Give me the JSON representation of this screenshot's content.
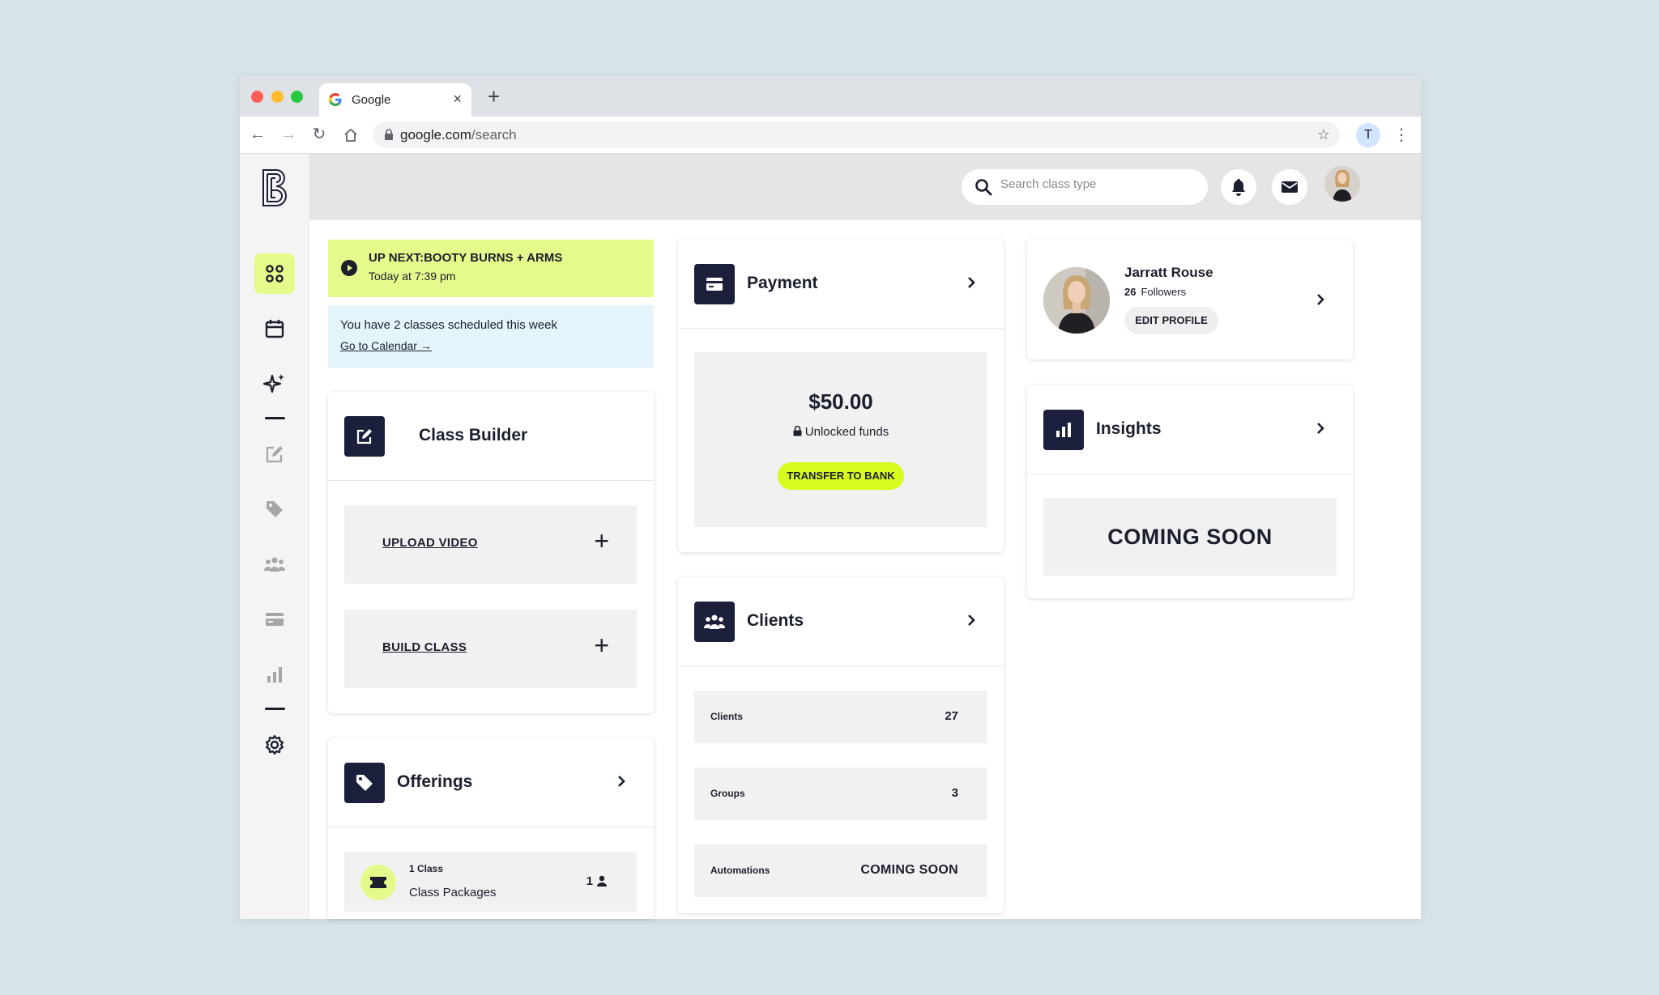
{
  "browser": {
    "tab_title": "Google",
    "tab_close": "×",
    "new_tab": "+",
    "url_host": "google.com",
    "url_path": "/search",
    "profile_initial": "T"
  },
  "topbar": {
    "search_placeholder": "Search class type"
  },
  "upnext": {
    "title": "UP NEXT:BOOTY BURNS + ARMS",
    "time": "Today at 7:39 pm"
  },
  "week": {
    "message": "You have 2 classes scheduled this week",
    "calendar_link": "Go to Calendar →"
  },
  "class_builder": {
    "title": "Class Builder",
    "upload_label": "UPLOAD VIDEO",
    "build_label": "BUILD CLASS",
    "plus": "+"
  },
  "offerings": {
    "title": "Offerings",
    "item_small": "1 Class",
    "item_label": "Class Packages",
    "item_count": "1"
  },
  "payment": {
    "title": "Payment",
    "amount": "$50.00",
    "unlocked": "Unlocked funds",
    "transfer_label": "TRANSFER TO BANK"
  },
  "clients": {
    "title": "Clients",
    "rows": [
      {
        "label": "Clients",
        "value": "27"
      },
      {
        "label": "Groups",
        "value": "3"
      },
      {
        "label": "Automations",
        "value": "COMING SOON"
      }
    ]
  },
  "profile": {
    "name": "Jarratt Rouse",
    "followers_count": "26",
    "followers_label": "Followers",
    "edit_label": "EDIT PROFILE"
  },
  "insights": {
    "title": "Insights",
    "status": "COMING SOON"
  },
  "colors": {
    "accent_lime": "#e3fb8b",
    "button_lime": "#d7fb1d",
    "navy": "#1b1f3b",
    "info_blue": "#e3f5fb"
  },
  "icons": {
    "sidebar": [
      "dashboard-icon",
      "calendar-icon",
      "sparkle-icon",
      "edit-icon",
      "tag-icon",
      "users-icon",
      "card-icon",
      "bar-chart-icon",
      "gear-icon"
    ]
  }
}
